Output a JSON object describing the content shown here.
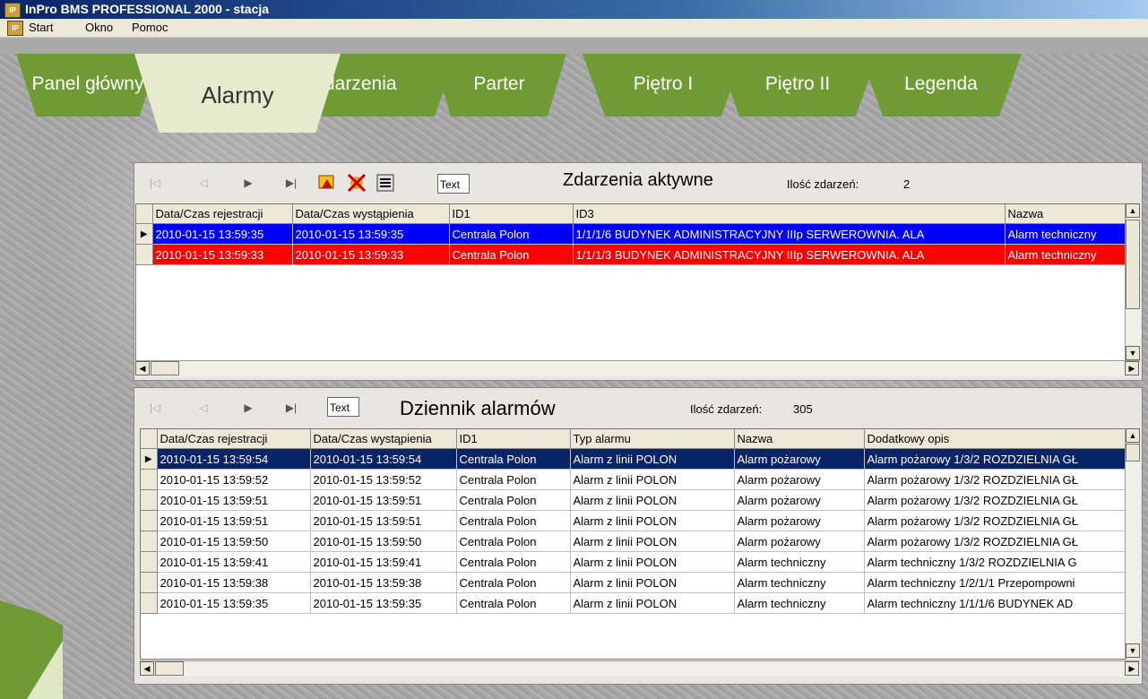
{
  "window": {
    "title": "InPro BMS PROFESSIONAL 2000 - stacja",
    "app_icon": "IP"
  },
  "menu": {
    "icon": "IP",
    "items": [
      "Start",
      "Okno",
      "Pomoc"
    ]
  },
  "tabs": [
    {
      "label": "Panel główny",
      "active": false
    },
    {
      "label": "Alarmy",
      "active": true
    },
    {
      "label": "darzenia",
      "active": false
    },
    {
      "label": "Parter",
      "active": false
    },
    {
      "label": "Piętro I",
      "active": false
    },
    {
      "label": "Piętro II",
      "active": false
    },
    {
      "label": "Legenda",
      "active": false
    }
  ],
  "active_events": {
    "title": "Zdarzenia aktywne",
    "count_label": "Ilość zdarzeń:",
    "count": "2",
    "text_button": "Text",
    "columns": [
      "Data/Czas rejestracji",
      "Data/Czas wystąpienia",
      "ID1",
      "ID3",
      "Nazwa"
    ],
    "rows": [
      {
        "style": "blue",
        "cells": [
          "2010-01-15 13:59:35",
          "2010-01-15 13:59:35",
          "Centrala Polon",
          "1/1/1/6 BUDYNEK ADMINISTRACYJNY IIIp SERWEROWNIA. ALA",
          "Alarm techniczny"
        ]
      },
      {
        "style": "red",
        "cells": [
          "2010-01-15 13:59:33",
          "2010-01-15 13:59:33",
          "Centrala Polon",
          "1/1/1/3 BUDYNEK ADMINISTRACYJNY IIIp SERWEROWNIA. ALA",
          "Alarm techniczny"
        ]
      }
    ]
  },
  "alarm_log": {
    "title": "Dziennik alarmów",
    "count_label": "Ilość zdarzeń:",
    "count": "305",
    "text_button": "Text",
    "columns": [
      "Data/Czas rejestracji",
      "Data/Czas wystąpienia",
      "ID1",
      "Typ alarmu",
      "Nazwa",
      "Dodatkowy opis"
    ],
    "rows": [
      [
        "2010-01-15 13:59:54",
        "2010-01-15 13:59:54",
        "Centrala Polon",
        "Alarm z linii POLON",
        "Alarm pożarowy",
        "Alarm pożarowy 1/3/2 ROZDZIELNIA GŁ"
      ],
      [
        "2010-01-15 13:59:52",
        "2010-01-15 13:59:52",
        "Centrala Polon",
        "Alarm z linii POLON",
        "Alarm pożarowy",
        "Alarm pożarowy 1/3/2 ROZDZIELNIA GŁ"
      ],
      [
        "2010-01-15 13:59:51",
        "2010-01-15 13:59:51",
        "Centrala Polon",
        "Alarm z linii POLON",
        "Alarm pożarowy",
        "Alarm pożarowy 1/3/2 ROZDZIELNIA GŁ"
      ],
      [
        "2010-01-15 13:59:51",
        "2010-01-15 13:59:51",
        "Centrala Polon",
        "Alarm z linii POLON",
        "Alarm pożarowy",
        "Alarm pożarowy 1/3/2 ROZDZIELNIA GŁ"
      ],
      [
        "2010-01-15 13:59:50",
        "2010-01-15 13:59:50",
        "Centrala Polon",
        "Alarm z linii POLON",
        "Alarm pożarowy",
        "Alarm pożarowy 1/3/2 ROZDZIELNIA GŁ"
      ],
      [
        "2010-01-15 13:59:41",
        "2010-01-15 13:59:41",
        "Centrala Polon",
        "Alarm z linii POLON",
        "Alarm techniczny",
        "Alarm techniczny 1/3/2 ROZDZIELNIA G"
      ],
      [
        "2010-01-15 13:59:38",
        "2010-01-15 13:59:38",
        "Centrala Polon",
        "Alarm z linii POLON",
        "Alarm techniczny",
        "Alarm techniczny 1/2/1/1 Przepompowni"
      ],
      [
        "2010-01-15 13:59:35",
        "2010-01-15 13:59:35",
        "Centrala Polon",
        "Alarm z linii POLON",
        "Alarm techniczny",
        "Alarm techniczny 1/1/1/6 BUDYNEK AD"
      ]
    ]
  },
  "colors": {
    "tab_green": "#6f9a35",
    "tab_active": "#e7ebcd",
    "row_blue": "#0000ff",
    "row_red": "#ff0000",
    "row_selected": "#0a246a"
  }
}
